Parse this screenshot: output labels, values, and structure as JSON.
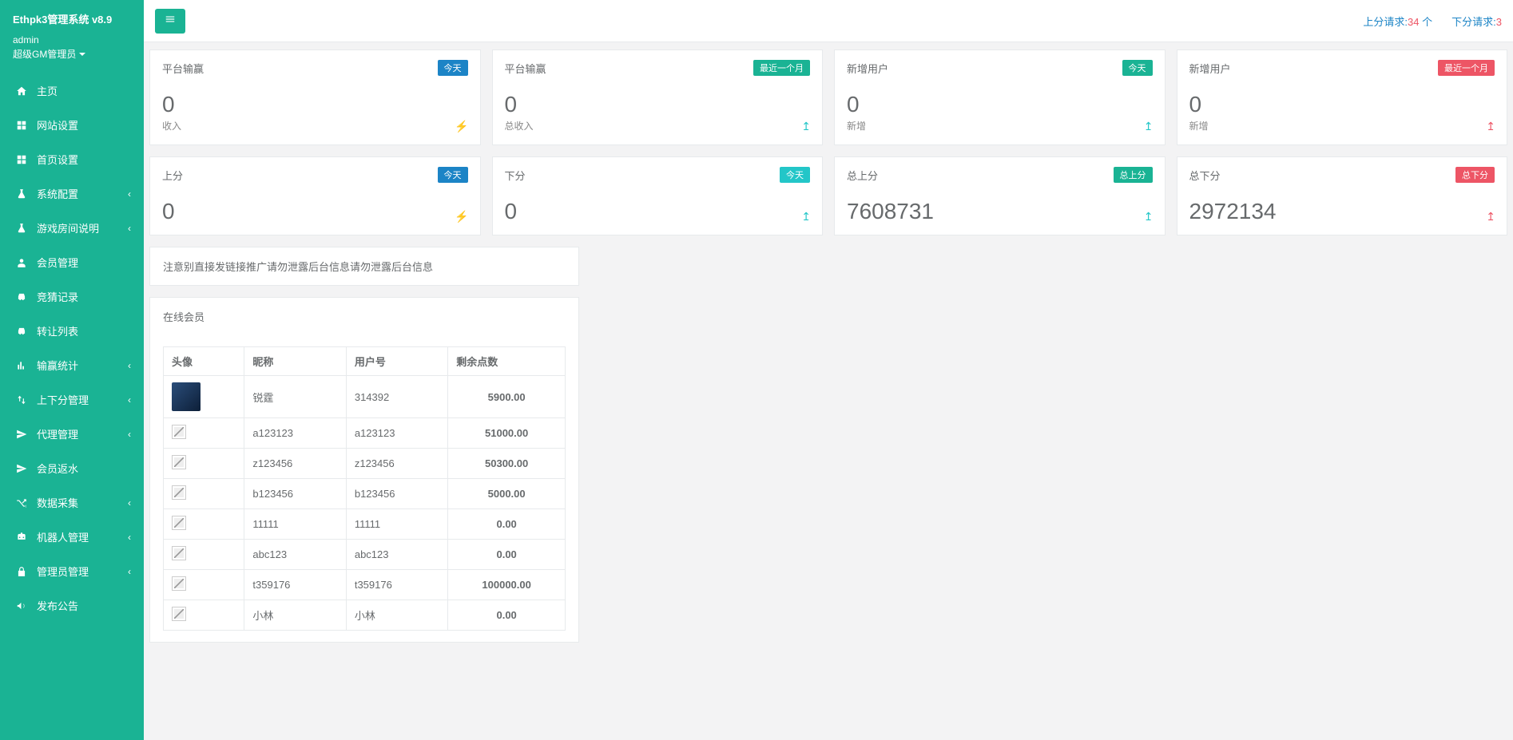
{
  "sidebar": {
    "title": "Ethpk3管理系统 v8.9",
    "user": "admin",
    "role": "超级GM管理员",
    "items": [
      {
        "icon": "home",
        "label": "主页",
        "expandable": false
      },
      {
        "icon": "th",
        "label": "网站设置",
        "expandable": false
      },
      {
        "icon": "th",
        "label": "首页设置",
        "expandable": false
      },
      {
        "icon": "flask",
        "label": "系统配置",
        "expandable": true
      },
      {
        "icon": "flask",
        "label": "游戏房间说明",
        "expandable": true
      },
      {
        "icon": "user",
        "label": "会员管理",
        "expandable": false
      },
      {
        "icon": "car",
        "label": "竞猜记录",
        "expandable": false
      },
      {
        "icon": "car",
        "label": "转让列表",
        "expandable": false
      },
      {
        "icon": "bar",
        "label": "输赢统计",
        "expandable": true
      },
      {
        "icon": "updown",
        "label": "上下分管理",
        "expandable": true
      },
      {
        "icon": "send",
        "label": "代理管理",
        "expandable": true
      },
      {
        "icon": "send",
        "label": "会员返水",
        "expandable": false
      },
      {
        "icon": "random",
        "label": "数据采集",
        "expandable": true
      },
      {
        "icon": "robot",
        "label": "机器人管理",
        "expandable": true
      },
      {
        "icon": "lock",
        "label": "管理员管理",
        "expandable": true
      },
      {
        "icon": "bullhorn",
        "label": "发布公告",
        "expandable": false
      }
    ]
  },
  "topbar": {
    "left_label": "上分请求:",
    "left_count": "34",
    "left_unit": " 个",
    "right_label": "下分请求:",
    "right_count": "3"
  },
  "cards_row1": [
    {
      "title": "平台输赢",
      "badge": "今天",
      "badge_cls": "badge-primary",
      "value": "0",
      "sub": "收入",
      "ind": "⚡",
      "ind_cls": "blue"
    },
    {
      "title": "平台输赢",
      "badge": "最近一个月",
      "badge_cls": "badge-success",
      "value": "0",
      "sub": "总收入",
      "ind": "↥",
      "ind_cls": "teal"
    },
    {
      "title": "新增用户",
      "badge": "今天",
      "badge_cls": "badge-success",
      "value": "0",
      "sub": "新增",
      "ind": "↥",
      "ind_cls": "teal"
    },
    {
      "title": "新增用户",
      "badge": "最近一个月",
      "badge_cls": "badge-danger",
      "value": "0",
      "sub": "新增",
      "ind": "↥",
      "ind_cls": "red"
    }
  ],
  "cards_row2": [
    {
      "title": "上分",
      "badge": "今天",
      "badge_cls": "badge-primary",
      "value": "0",
      "sub": "",
      "ind": "⚡",
      "ind_cls": "blue"
    },
    {
      "title": "下分",
      "badge": "今天",
      "badge_cls": "badge-info",
      "value": "0",
      "sub": "",
      "ind": "↥",
      "ind_cls": "teal"
    },
    {
      "title": "总上分",
      "badge": "总上分",
      "badge_cls": "badge-success",
      "value": "7608731",
      "sub": "",
      "ind": "↥",
      "ind_cls": "teal"
    },
    {
      "title": "总下分",
      "badge": "总下分",
      "badge_cls": "badge-danger",
      "value": "2972134",
      "sub": "",
      "ind": "↥",
      "ind_cls": "red"
    }
  ],
  "notice": "注意别直接发链接推广请勿泄露后台信息请勿泄露后台信息",
  "online": {
    "title": "在线会员",
    "headers": [
      "头像",
      "昵称",
      "用户号",
      "剩余点数"
    ],
    "rows": [
      {
        "avatar": "true",
        "nick": "锐霆",
        "uid": "314392",
        "pts": "5900.00"
      },
      {
        "avatar": "broken",
        "nick": "a123123",
        "uid": "a123123",
        "pts": "51000.00"
      },
      {
        "avatar": "broken",
        "nick": "z123456",
        "uid": "z123456",
        "pts": "50300.00"
      },
      {
        "avatar": "broken",
        "nick": "b123456",
        "uid": "b123456",
        "pts": "5000.00"
      },
      {
        "avatar": "broken",
        "nick": "11111",
        "uid": "11111",
        "pts": "0.00"
      },
      {
        "avatar": "broken",
        "nick": "abc123",
        "uid": "abc123",
        "pts": "0.00"
      },
      {
        "avatar": "broken",
        "nick": "t359176",
        "uid": "t359176",
        "pts": "100000.00"
      },
      {
        "avatar": "broken",
        "nick": "小林",
        "uid": "小林",
        "pts": "0.00"
      }
    ]
  }
}
